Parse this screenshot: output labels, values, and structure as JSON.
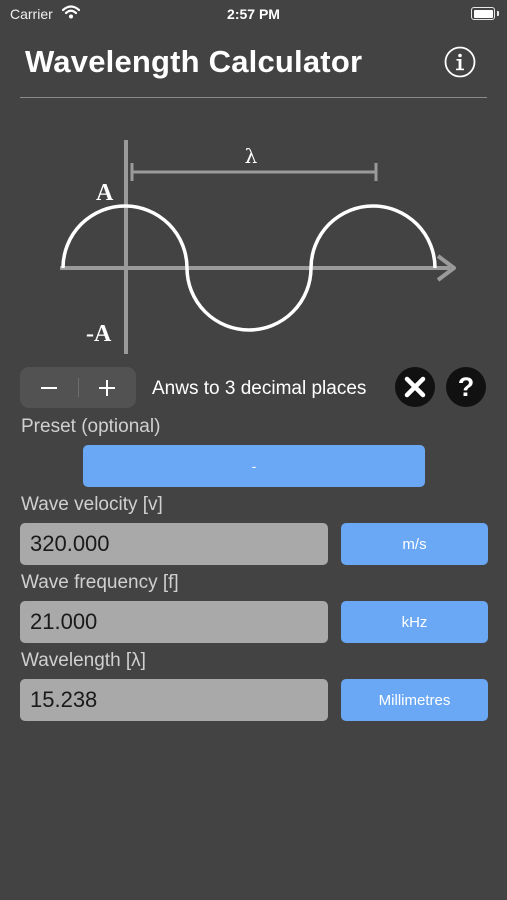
{
  "status_bar": {
    "carrier": "Carrier",
    "time": "2:57 PM"
  },
  "header": {
    "title": "Wavelength Calculator",
    "info_icon": "info-circle-icon"
  },
  "diagram": {
    "lambda_symbol": "λ",
    "amplitude_pos": "A",
    "amplitude_neg": "-A"
  },
  "controls": {
    "minus_label": "−",
    "plus_label": "+",
    "decimals_text": "Anws to 3 decimal places",
    "clear_icon": "close-circle-icon",
    "help_label": "?"
  },
  "preset": {
    "label": "Preset (optional)",
    "value": "-"
  },
  "fields": {
    "velocity": {
      "label": "Wave velocity [v]",
      "value": "320.000",
      "unit": "m/s"
    },
    "frequency": {
      "label": "Wave frequency [f]",
      "value": "21.000",
      "unit": "kHz"
    },
    "wavelength": {
      "label": "Wavelength [λ]",
      "value": "15.238",
      "unit": "Millimetres"
    }
  },
  "colors": {
    "background": "#434343",
    "accent_button": "#6aa8f5",
    "field_background": "#a9a9a9",
    "diagram_axes": "#9a9a9a",
    "wave_curve": "#ffffff"
  }
}
